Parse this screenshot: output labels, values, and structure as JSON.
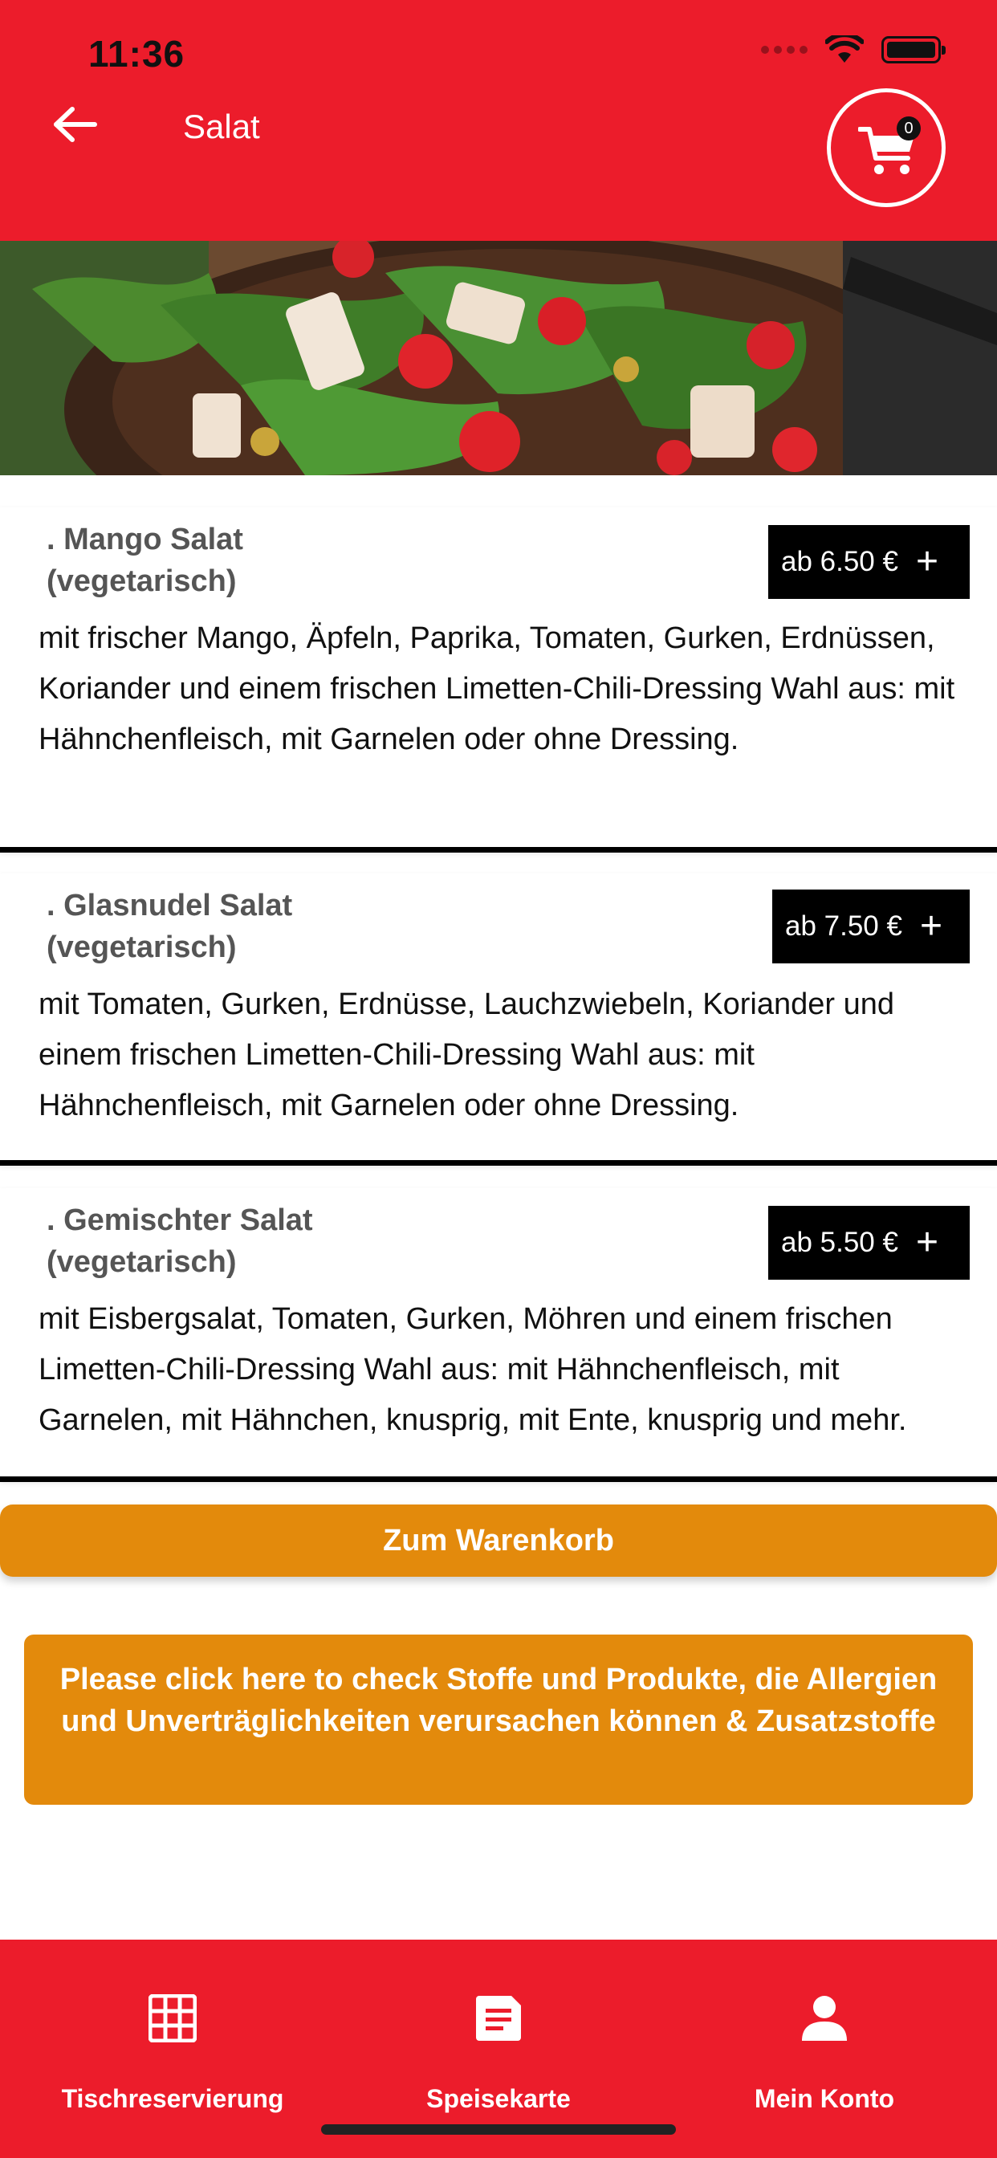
{
  "status_bar": {
    "time": "11:36"
  },
  "header": {
    "title": "Salat",
    "back_icon": "arrow-left-icon",
    "cart_icon": "cart-icon",
    "cart_count": "0"
  },
  "hero": {
    "image": "salad-with-chicken-strawberries-arugula"
  },
  "items": [
    {
      "name_line1": ". Mango Salat",
      "name_line2": "(vegetarisch)",
      "price": "ab 6.50 €",
      "plus": "+",
      "description": "mit frischer Mango, Äpfeln, Paprika, Tomaten, Gurken, Erdnüssen, Koriander und einem frischen Limetten-Chili-Dressing Wahl aus: mit Hähnchenfleisch, mit Garnelen oder ohne Dressing."
    },
    {
      "name_line1": ". Glasnudel Salat",
      "name_line2": "(vegetarisch)",
      "price": "ab 7.50 €",
      "plus": "+",
      "description": "mit Tomaten, Gurken, Erdnüsse, Lauchzwiebeln, Koriander und einem frischen Limetten-Chili-Dressing Wahl aus: mit Hähnchenfleisch, mit Garnelen oder ohne Dressing."
    },
    {
      "name_line1": ". Gemischter Salat",
      "name_line2": "(vegetarisch)",
      "price": "ab 5.50 €",
      "plus": "+",
      "description": "mit Eisbergsalat, Tomaten, Gurken, Möhren und einem frischen Limetten-Chili-Dressing Wahl aus: mit Hähnchenfleisch, mit Garnelen, mit Hähnchen, knusprig, mit Ente, knusprig und mehr."
    }
  ],
  "cart_button": "Zum Warenkorb",
  "allergy_button": "Please click here to check Stoffe und Produkte, die Allergien und Unverträglichkeiten verursachen können & Zusatzstoffe",
  "bottom_nav": [
    {
      "label": "Tischreservierung",
      "icon": "grid-icon"
    },
    {
      "label": "Speisekarte",
      "icon": "document-icon"
    },
    {
      "label": "Mein Konto",
      "icon": "person-icon"
    }
  ],
  "colors": {
    "primary_red": "#ec1c2b",
    "accent_orange": "#e38a0c",
    "price_bg": "#000000"
  }
}
